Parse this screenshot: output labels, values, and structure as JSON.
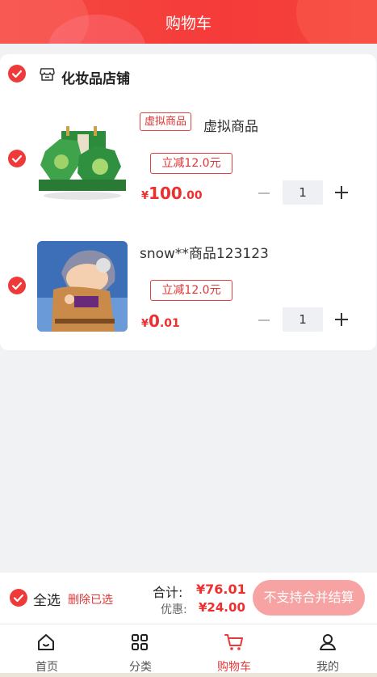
{
  "header": {
    "title": "购物车"
  },
  "shop": {
    "name": "化妆品店铺",
    "items": [
      {
        "tag": "虚拟商品",
        "name": "虚拟商品",
        "coupon": "立减12.0元",
        "currency": "¥",
        "price_int": "100",
        "price_dec": ".00",
        "qty": "1"
      },
      {
        "tag": "",
        "name": "snow**商品123123",
        "coupon": "立减12.0元",
        "currency": "¥",
        "price_int": "0",
        "price_dec": ".01",
        "qty": "1"
      }
    ]
  },
  "checkout": {
    "select_all": "全选",
    "delete_selected": "删除已选",
    "total_label": "合计:",
    "total_value": "¥76.01",
    "discount_label": "优惠:",
    "discount_value": "¥24.00",
    "pay_button": "不支持合并结算"
  },
  "tabbar": {
    "tabs": [
      {
        "label": "首页",
        "icon": "home-icon"
      },
      {
        "label": "分类",
        "icon": "grid-icon"
      },
      {
        "label": "购物车",
        "icon": "cart-icon",
        "active": true
      },
      {
        "label": "我的",
        "icon": "user-icon"
      }
    ]
  },
  "colors": {
    "accent": "#ef3a3a",
    "pay_button": "#f7a3a3",
    "background": "#f1f2f4"
  }
}
